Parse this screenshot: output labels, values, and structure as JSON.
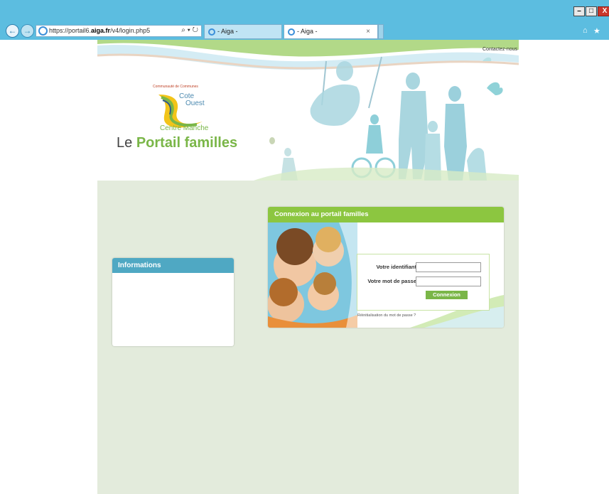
{
  "browser": {
    "url_prefix": "https://portail6.",
    "url_domain": "aiga.fr",
    "url_path": "/v4/login.php5",
    "addr_controls": "⌕ ▾ ↻",
    "tabs": [
      {
        "label": "- Aiga -"
      },
      {
        "label": "- Aiga -",
        "close": "×"
      }
    ],
    "window_buttons": {
      "minimize": "–",
      "restore": "□",
      "close": "X"
    },
    "toolbar_icons": {
      "home": "⌂",
      "favorites": "★"
    }
  },
  "header": {
    "contact_link": "Contactez-nous",
    "brand_small": "Communauté de Communes",
    "brand_line1": "Cote",
    "brand_line2": "Ouest",
    "brand_line3": "Centre Manche",
    "title_prefix": "Le ",
    "title_accent": "Portail familles"
  },
  "info_box": {
    "title": "Informations"
  },
  "login": {
    "title": "Connexion au portail familles",
    "username_label": "Votre identifiant",
    "password_label": "Votre mot de passe",
    "submit_label": "Connexion",
    "reset_link": "Réinitialisation du mot de passe ?"
  },
  "colors": {
    "titlebar": "#5cbde0",
    "page_bg": "#e3ebdc",
    "accent_green": "#8cc640",
    "info_blue": "#4fa8c3"
  }
}
